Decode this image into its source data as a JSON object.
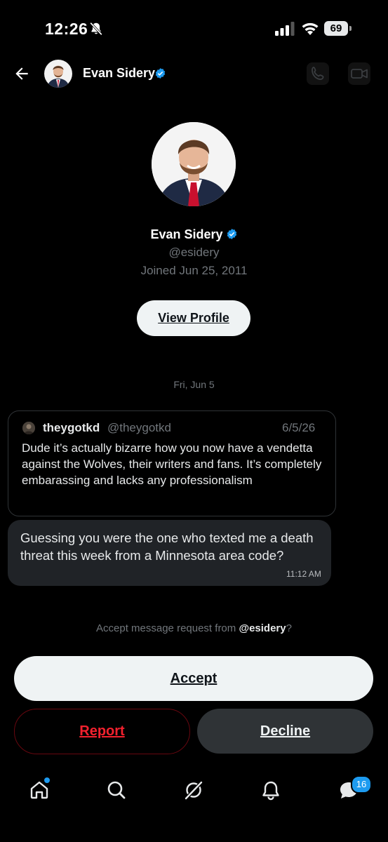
{
  "status_bar": {
    "time": "12:26",
    "battery": "69"
  },
  "header": {
    "name": "Evan Sidery"
  },
  "profile": {
    "name": "Evan Sidery",
    "handle": "@esidery",
    "joined": "Joined Jun 25, 2011",
    "view_profile_label": "View Profile"
  },
  "conversation": {
    "date_separator": "Fri, Jun 5",
    "quoted_post": {
      "author_name": "theygotkd",
      "author_handle": "@theygotkd",
      "date": "6/5/26",
      "text": "Dude it’s actually bizarre how you now have a vendetta against the Wolves, their writers and fans. It’s completely embarassing and lacks any professionalism"
    },
    "message": {
      "text": "Guessing you were the one who texted me a death threat this week from a Minnesota area code?",
      "time": "11:12 AM"
    }
  },
  "request": {
    "prefix": "Accept message request from ",
    "handle": "@esidery",
    "suffix": "?",
    "accept_label": "Accept",
    "report_label": "Report",
    "decline_label": "Decline"
  },
  "tab_bar": {
    "items": [
      "home-icon",
      "search-icon",
      "grok-icon",
      "notifications-icon",
      "messages-icon"
    ],
    "messages_badge": "16"
  },
  "colors": {
    "accent": "#1d9bf0",
    "danger": "#f4212e",
    "background": "#000000"
  }
}
